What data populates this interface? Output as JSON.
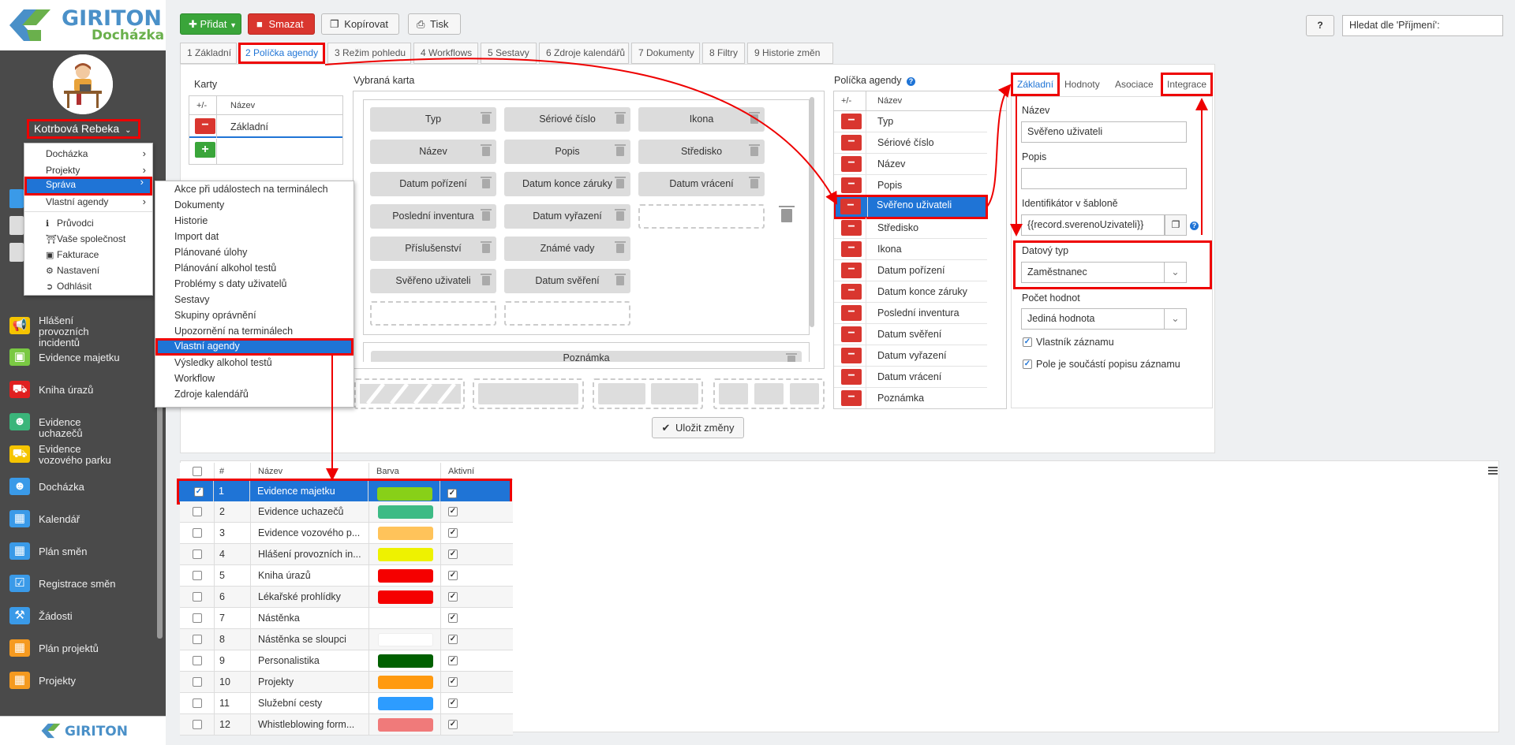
{
  "app": {
    "brand": "GIRITON",
    "product": "Docházka",
    "footer_brand": "GIRITON"
  },
  "user": {
    "name": "Kotrbová Rebeka"
  },
  "user_menu": [
    {
      "label": "Docházka",
      "has_sub": true
    },
    {
      "label": "Projekty",
      "has_sub": true
    },
    {
      "label": "Správa",
      "has_sub": true,
      "selected": true
    },
    {
      "label": "Vlastní agendy",
      "has_sub": true
    },
    {
      "label": "Průvodci",
      "icon": "info-icon"
    },
    {
      "label": "Vaše společnost",
      "icon": "bank-icon"
    },
    {
      "label": "Fakturace",
      "icon": "card-icon"
    },
    {
      "label": "Nastavení",
      "icon": "gear-icon"
    },
    {
      "label": "Odhlásit",
      "icon": "logout-icon"
    }
  ],
  "admin_submenu": [
    "Akce při událostech na terminálech",
    "Dokumenty",
    "Historie",
    "Import dat",
    "Plánované úlohy",
    "Plánování alkohol testů",
    "Problémy s daty uživatelů",
    "Sestavy",
    "Skupiny oprávnění",
    "Upozornění na terminálech",
    "Vlastní agendy",
    "Výsledky alkohol testů",
    "Workflow",
    "Zdroje kalendářů"
  ],
  "sidebar_nav": [
    {
      "label": "Hlášení provozních incidentů",
      "icon": "megaphone-icon",
      "color": "#f5c400"
    },
    {
      "label": "Evidence majetku",
      "icon": "box-icon",
      "color": "#7ac943"
    },
    {
      "label": "Kniha úrazů",
      "icon": "ambulance-icon",
      "color": "#e02020"
    },
    {
      "label": "Evidence uchazečů",
      "icon": "user-add-icon",
      "color": "#3ab57a"
    },
    {
      "label": "Evidence vozového parku",
      "icon": "car-icon",
      "color": "#f5c400"
    },
    {
      "label": "Docházka",
      "icon": "user-icon",
      "color": "#3a9ae8"
    },
    {
      "label": "Kalendář",
      "icon": "calendar-icon",
      "color": "#3a9ae8"
    },
    {
      "label": "Plán směn",
      "icon": "calendar-grid-icon",
      "color": "#3a9ae8"
    },
    {
      "label": "Registrace směn",
      "icon": "calendar-check-icon",
      "color": "#3a9ae8"
    },
    {
      "label": "Žádosti",
      "icon": "gavel-icon",
      "color": "#3a9ae8"
    },
    {
      "label": "Plán projektů",
      "icon": "calendar-grid-icon",
      "color": "#f59a20"
    },
    {
      "label": "Projekty",
      "icon": "calendar-icon",
      "color": "#f59a20"
    }
  ],
  "toolbar": {
    "add": "Přidat",
    "delete": "Smazat",
    "copy": "Kopírovat",
    "print": "Tisk",
    "help": "?"
  },
  "search": {
    "placeholder": "Hledat dle 'Příjmení':"
  },
  "tabs": [
    "1 Základní",
    "2 Políčka agendy",
    "3 Režim pohledu",
    "4 Workflows",
    "5 Sestavy",
    "6 Zdroje kalendářů",
    "7 Dokumenty",
    "8 Filtry",
    "9 Historie změn"
  ],
  "cards": {
    "title": "Karty",
    "col_pm": "+/-",
    "col_name": "Název",
    "rows": [
      "Základní"
    ]
  },
  "selected_card": {
    "title": "Vybraná karta",
    "fields": [
      [
        "Typ",
        "Sériové číslo",
        "Ikona"
      ],
      [
        "Název",
        "Popis",
        "Středisko"
      ],
      [
        "Datum pořízení",
        "Datum konce záruky",
        "Datum vrácení"
      ],
      [
        "Poslední inventura",
        "Datum vyřazení"
      ],
      [
        "Příslušenství",
        "Známé vady"
      ],
      [
        "Svěřeno uživateli",
        "Datum svěření"
      ]
    ],
    "next_block": "Poznámka"
  },
  "save_button": "Uložit změny",
  "agenda_fields": {
    "title": "Políčka agendy",
    "col_pm": "+/-",
    "col_name": "Název",
    "rows": [
      "Typ",
      "Sériové číslo",
      "Název",
      "Popis",
      "Svěřeno uživateli",
      "Středisko",
      "Ikona",
      "Datum pořízení",
      "Datum konce záruky",
      "Poslední inventura",
      "Datum svěření",
      "Datum vyřazení",
      "Datum vrácení",
      "Poznámka"
    ],
    "selected": "Svěřeno uživateli"
  },
  "props": {
    "tabs": [
      "Základní",
      "Hodnoty",
      "Asociace",
      "Integrace"
    ],
    "name_label": "Název",
    "name_value": "Svěřeno uživateli",
    "desc_label": "Popis",
    "desc_value": "",
    "tpl_label": "Identifikátor v šabloně",
    "tpl_value": "{{record.sverenoUzivateli}}",
    "type_label": "Datový typ",
    "type_value": "Zaměstnanec",
    "count_label": "Počet hodnot",
    "count_value": "Jediná hodnota",
    "owner_label": "Vlastník záznamu",
    "desc_part_label": "Pole je součástí popisu záznamu"
  },
  "agenda_list": {
    "headers": [
      "#",
      "Název",
      "Barva",
      "Aktivní"
    ],
    "rows": [
      {
        "n": "1",
        "name": "Evidence majetku",
        "color": "#88d018",
        "selected": true
      },
      {
        "n": "2",
        "name": "Evidence uchazečů",
        "color": "#3dbb85"
      },
      {
        "n": "3",
        "name": "Evidence vozového p...",
        "color": "#ffc35a"
      },
      {
        "n": "4",
        "name": "Hlášení provozních in...",
        "color": "#eef200"
      },
      {
        "n": "5",
        "name": "Kniha úrazů",
        "color": "#f50000"
      },
      {
        "n": "6",
        "name": "Lékařské prohlídky",
        "color": "#f50000"
      },
      {
        "n": "7",
        "name": "Nástěnka",
        "color": ""
      },
      {
        "n": "8",
        "name": "Nástěnka se sloupci",
        "color": "#ffffff"
      },
      {
        "n": "9",
        "name": "Personalistika",
        "color": "#006000"
      },
      {
        "n": "10",
        "name": "Projekty",
        "color": "#ff9a10"
      },
      {
        "n": "11",
        "name": "Služební cesty",
        "color": "#2d9cff"
      },
      {
        "n": "12",
        "name": "Whistleblowing form...",
        "color": "#f07a7a"
      }
    ]
  }
}
